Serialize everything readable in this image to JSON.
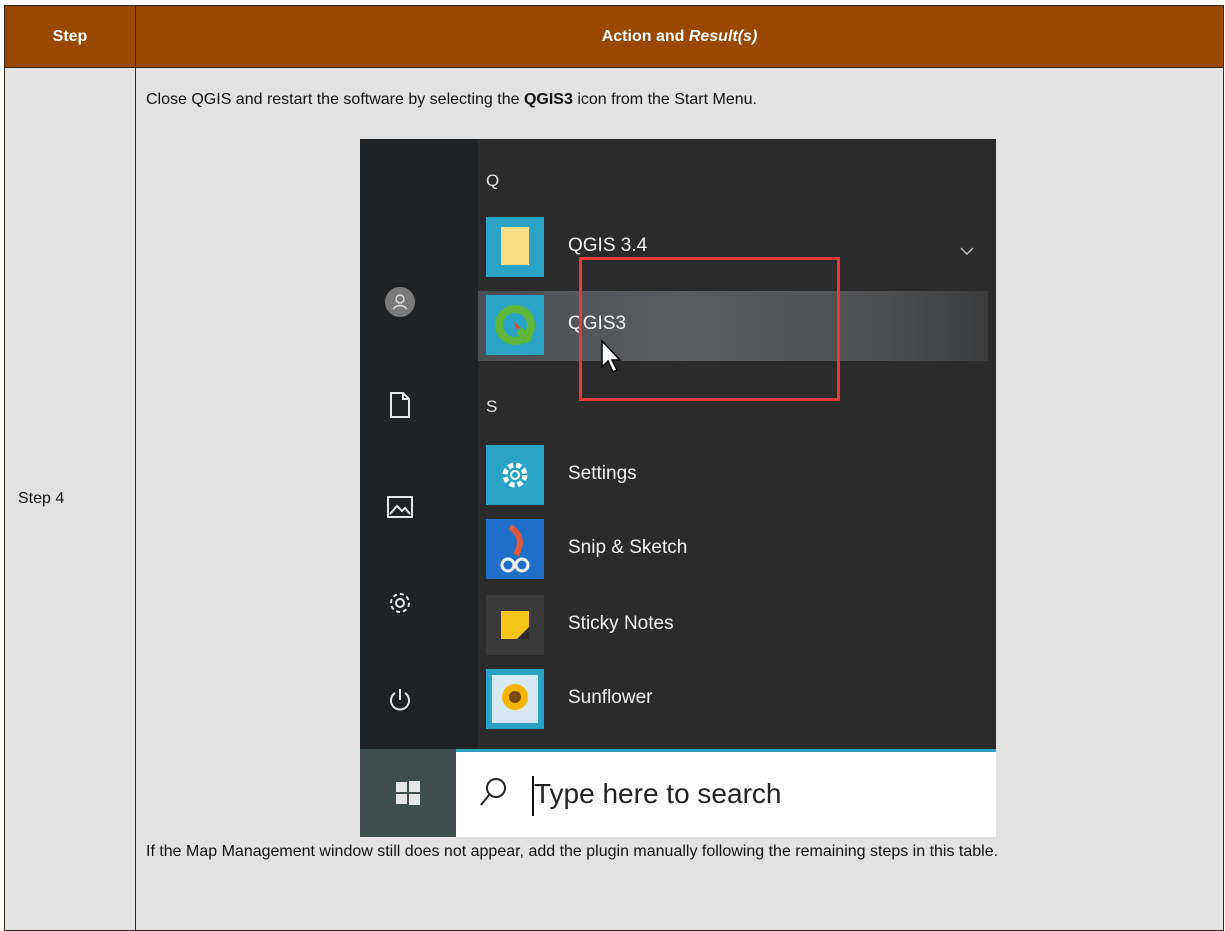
{
  "table": {
    "header_step": "Step",
    "header_action": "Action and ",
    "header_result": "Result(s)",
    "step_label": "Step 4",
    "intro_before": "Close QGIS and restart the software by selecting the ",
    "intro_bold": "QGIS3",
    "intro_after": " icon from the Start Menu.",
    "outro": "If the Map Management window still does not appear, add the plugin manually following the remaining steps in this table."
  },
  "start_menu": {
    "group_q": "Q",
    "group_s": "S",
    "apps": [
      "QGIS 3.4",
      "QGIS3",
      "Settings",
      "Snip & Sketch",
      "Sticky Notes",
      "Sunflower"
    ],
    "search_placeholder": "Type here to search",
    "colors": {
      "tile_blue": "#2ba3c7",
      "highlight_red": "#e53b3b",
      "header_brown": "#9a4700"
    }
  }
}
